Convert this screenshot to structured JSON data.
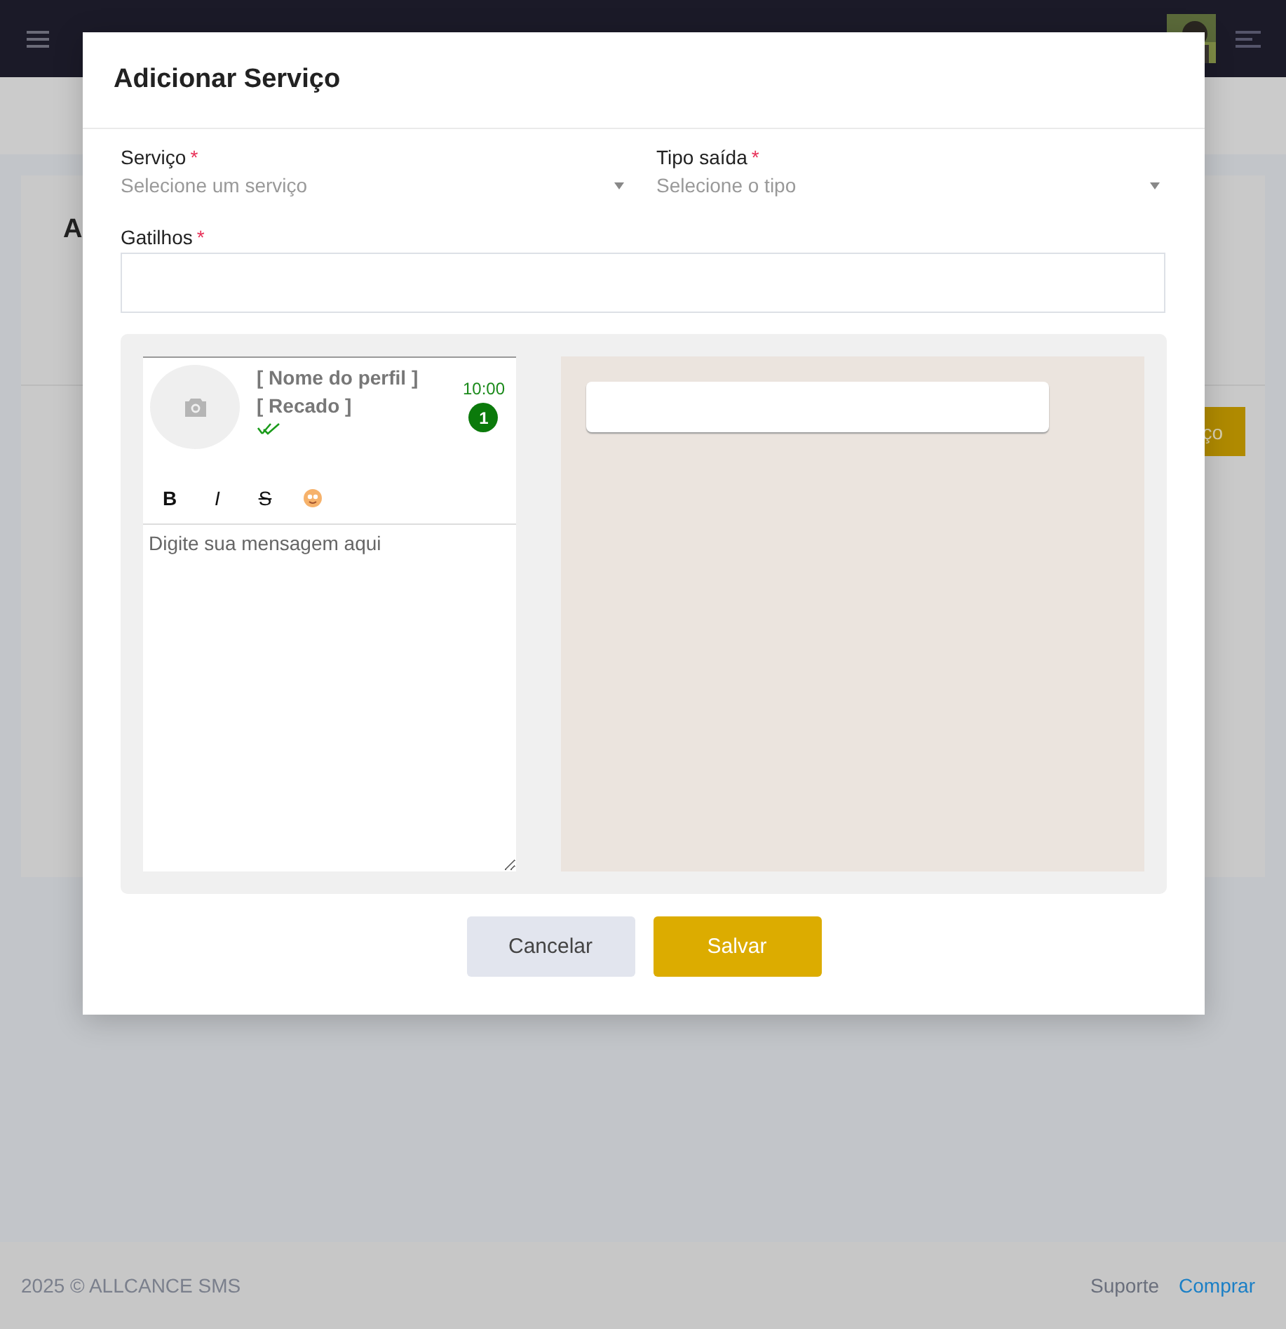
{
  "background": {
    "card_title": "A",
    "action_button": "ço",
    "footer": {
      "copyright": "2025 © ALLCANCE SMS",
      "links": [
        {
          "label": "Suporte",
          "kind": "plain"
        },
        {
          "label": "Comprar",
          "kind": "link"
        }
      ]
    }
  },
  "modal": {
    "title": "Adicionar Serviço",
    "selects": [
      {
        "label": "Serviço",
        "mark": "*",
        "placeholder": "Selecione um serviço"
      },
      {
        "label": "Tipo saída",
        "mark": "*",
        "placeholder": "Selecione o tipo"
      }
    ],
    "triggers": {
      "label": "Gatilhos",
      "mark": "*"
    },
    "preview": {
      "profile_name": "[ Nome do perfil ]",
      "status": "[ Recado ]",
      "time": "10:00",
      "unread": "1",
      "toolbar": [
        {
          "label": "B",
          "kind": "bold"
        },
        {
          "label": "I",
          "kind": "italic"
        },
        {
          "label": "S",
          "kind": "strike"
        },
        {
          "kind": "emoji"
        }
      ],
      "message_placeholder": "Digite sua mensagem aqui"
    },
    "buttons": [
      {
        "label": "Cancelar",
        "kind": "secondary"
      },
      {
        "label": "Salvar",
        "kind": "primary"
      }
    ]
  }
}
